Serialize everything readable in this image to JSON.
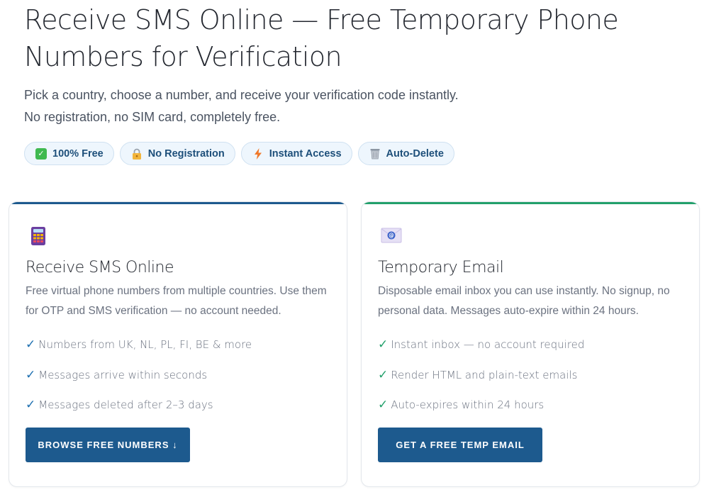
{
  "hero": {
    "title": "Receive SMS Online — Free Temporary Phone Numbers for Verification",
    "subtitle": "Pick a country, choose a number, and receive your verification code instantly. No registration, no SIM card, completely free."
  },
  "badges": [
    {
      "label": "100% Free",
      "icon": "check-box-icon"
    },
    {
      "label": "No Registration",
      "icon": "lock-icon"
    },
    {
      "label": "Instant Access",
      "icon": "lightning-icon"
    },
    {
      "label": "Auto-Delete",
      "icon": "wastebasket-icon"
    }
  ],
  "cards": {
    "sms": {
      "icon": "calculator-phone-icon",
      "title": "Receive SMS Online",
      "description": "Free virtual phone numbers from multiple countries. Use them for OTP and SMS verification — no account needed.",
      "features": [
        "Numbers from UK, NL, PL, FI, BE & more",
        "Messages arrive within seconds",
        "Messages deleted after 2–3 days"
      ],
      "cta": "BROWSE FREE NUMBERS ↓"
    },
    "mail": {
      "icon": "email-icon",
      "title": "Temporary Email",
      "description": "Disposable email inbox you can use instantly. No signup, no personal data. Messages auto-expire within 24 hours.",
      "features": [
        "Instant inbox — no account required",
        "Render HTML and plain-text emails",
        "Auto-expires within 24 hours"
      ],
      "cta": "GET A FREE TEMP EMAIL"
    }
  },
  "colors": {
    "primary": "#1d5a8e",
    "accent_green": "#22a06b",
    "badge_bg": "#eef6fd"
  },
  "tick_glyph": "✓"
}
